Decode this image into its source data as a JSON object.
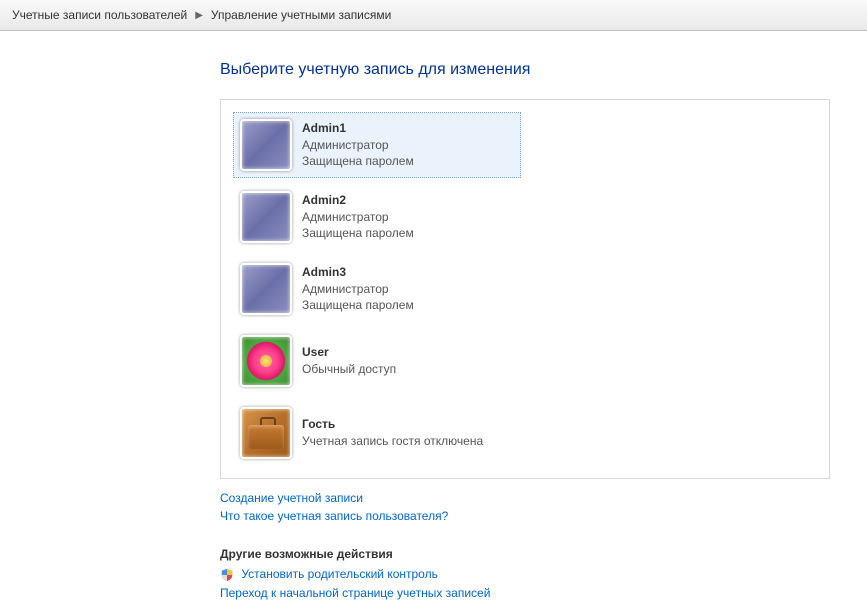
{
  "breadcrumb": {
    "level1": "Учетные записи пользователей",
    "level2": "Управление учетными записями"
  },
  "heading": "Выберите учетную запись для изменения",
  "accounts": [
    {
      "name": "Admin1",
      "role": "Администратор",
      "status": "Защищена паролем",
      "avatar": "default",
      "selected": true
    },
    {
      "name": "Admin2",
      "role": "Администратор",
      "status": "Защищена паролем",
      "avatar": "default",
      "selected": false
    },
    {
      "name": "Admin3",
      "role": "Администратор",
      "status": "Защищена паролем",
      "avatar": "default",
      "selected": false
    },
    {
      "name": "User",
      "role": "Обычный доступ",
      "status": "",
      "avatar": "flower",
      "selected": false
    },
    {
      "name": "Гость",
      "role": "Учетная запись гостя отключена",
      "status": "",
      "avatar": "briefcase",
      "selected": false
    }
  ],
  "links": {
    "create": "Создание учетной записи",
    "what_is": "Что такое учетная запись пользователя?"
  },
  "actions": {
    "heading": "Другие возможные действия",
    "parental": "Установить родительский контроль",
    "goto_main": "Переход к начальной странице учетных записей"
  }
}
